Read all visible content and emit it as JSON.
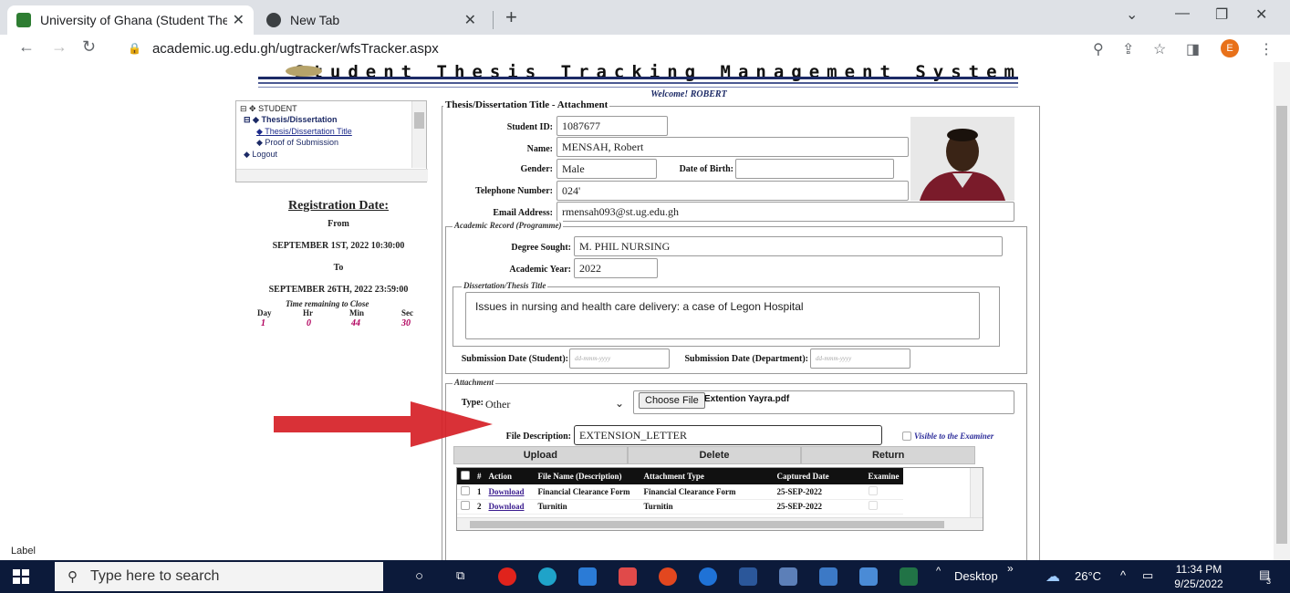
{
  "browser": {
    "tabs": [
      {
        "title": "University of Ghana (Student The",
        "active": true
      },
      {
        "title": "New Tab",
        "active": false
      }
    ],
    "url": "academic.ug.edu.gh/ugtracker/wfsTracker.aspx",
    "profile_initial": "E"
  },
  "header": {
    "banner": "Student Thesis Tracking Management System",
    "welcome": "Welcome! ROBERT"
  },
  "tree": {
    "root": "STUDENT",
    "group": "Thesis/Dissertation",
    "items": [
      "Thesis/Dissertation Title",
      "Proof of Submission"
    ],
    "logout": "Logout"
  },
  "registration": {
    "title": "Registration Date:",
    "from_label": "From",
    "from_date": "SEPTEMBER 1ST, 2022 10:30:00",
    "to_label": "To",
    "to_date": "SEPTEMBER 26TH, 2022 23:59:00",
    "time_remaining_label": "Time remaining to Close",
    "countdown": [
      {
        "unit": "Day",
        "value": "1"
      },
      {
        "unit": "Hr",
        "value": "0"
      },
      {
        "unit": "Min",
        "value": "44"
      },
      {
        "unit": "Sec",
        "value": "30"
      }
    ]
  },
  "form": {
    "legend": "Thesis/Dissertation Title - Attachment",
    "student_id": {
      "label": "Student ID:",
      "value": "1087677"
    },
    "name": {
      "label": "Name:",
      "value": "MENSAH, Robert"
    },
    "gender": {
      "label": "Gender:",
      "value": "Male"
    },
    "dob": {
      "label": "Date of Birth:",
      "value": ""
    },
    "telephone": {
      "label": "Telephone Number:",
      "value": "024'"
    },
    "email": {
      "label": "Email Address:",
      "value": "rmensah093@st.ug.edu.gh"
    },
    "academic": {
      "legend": "Academic Record (Programme)",
      "degree": {
        "label": "Degree Sought:",
        "value": "M. PHIL NURSING"
      },
      "year": {
        "label": "Academic Year:",
        "value": "2022"
      }
    },
    "thesis": {
      "legend": "Dissertation/Thesis Title",
      "title": "Issues in nursing and health care delivery: a case of Legon Hospital"
    },
    "submission_student": {
      "label": "Submission Date (Student):",
      "placeholder": "dd-mmm-yyyy"
    },
    "submission_department": {
      "label": "Submission Date (Department):",
      "placeholder": "dd-mmm-yyyy"
    },
    "attachment": {
      "legend": "Attachment",
      "type_label": "Type:",
      "type_value": "Other",
      "choose_label": "Choose File",
      "chosen_file": "Extention Yayra.pdf",
      "file_description_label": "File Description:",
      "file_description_value": "EXTENSION_LETTER",
      "visible_label": "Visible to the Examiner"
    },
    "buttons": {
      "upload": "Upload",
      "delete": "Delete",
      "return": "Return"
    },
    "grid": {
      "columns": [
        "#",
        "Action",
        "File Name (Description)",
        "Attachment Type",
        "Captured Date",
        "Examine"
      ],
      "rows": [
        {
          "num": "1",
          "action": "Download",
          "file": "Financial Clearance Form",
          "type": "Financial Clearance Form",
          "date": "25-SEP-2022"
        },
        {
          "num": "2",
          "action": "Download",
          "file": "Turnitin",
          "type": "Turnitin",
          "date": "25-SEP-2022"
        }
      ]
    }
  },
  "page_label": "Label",
  "taskbar": {
    "search_placeholder": "Type here to search",
    "desktop_label": "Desktop",
    "weather": "26°C",
    "time": "11:34 PM",
    "date": "9/25/2022",
    "notifications": "3"
  }
}
